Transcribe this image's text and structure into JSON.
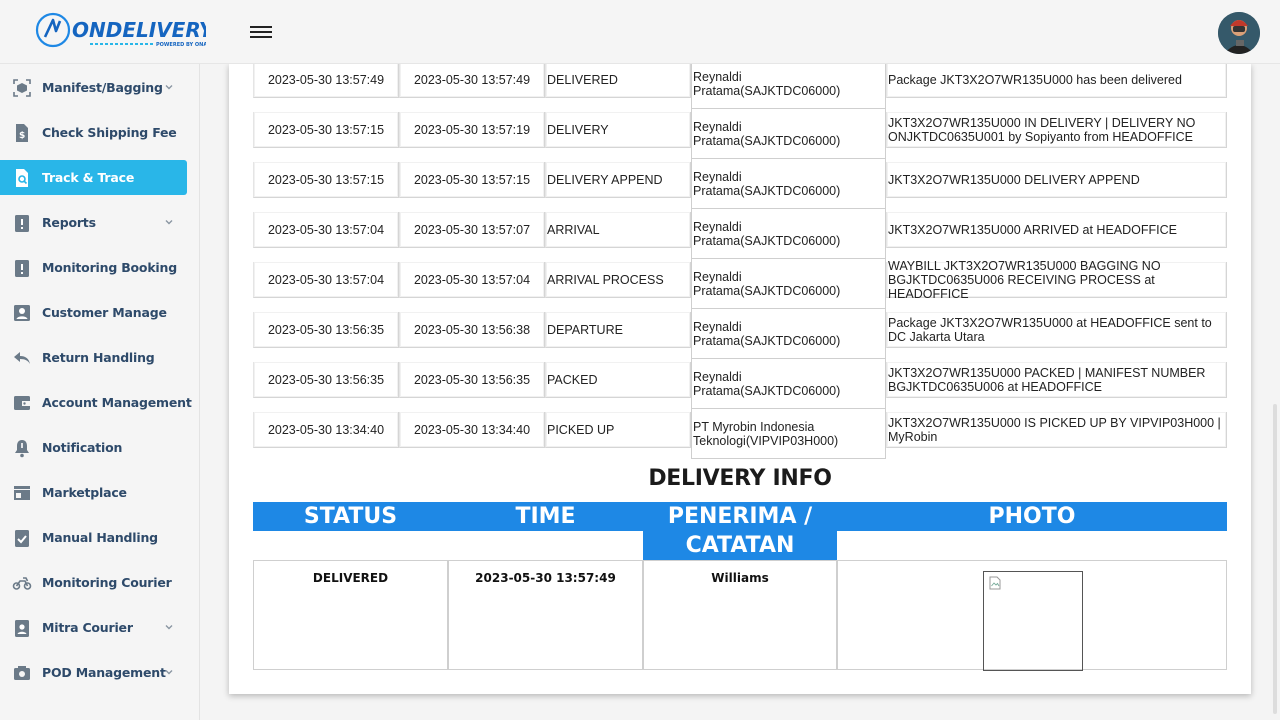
{
  "header": {
    "logo_text": "ONDELIVERY",
    "logo_tagline": "POWERED BY ONAPPS"
  },
  "sidebar": {
    "items": [
      {
        "label": "Manifest/Bagging",
        "icon": "box-scan-icon",
        "chevron": true
      },
      {
        "label": "Check Shipping Fee",
        "icon": "dollar-document-icon",
        "chevron": false
      },
      {
        "label": "Track & Trace",
        "icon": "search-document-icon",
        "chevron": false,
        "active": true
      },
      {
        "label": "Reports",
        "icon": "alert-clipboard-icon",
        "chevron": true
      },
      {
        "label": "Monitoring Booking",
        "icon": "alert-clipboard-icon",
        "chevron": false
      },
      {
        "label": "Customer Manage",
        "icon": "person-card-icon",
        "chevron": false
      },
      {
        "label": "Return Handling",
        "icon": "reply-arrow-icon",
        "chevron": false
      },
      {
        "label": "Account Management",
        "icon": "wallet-icon",
        "chevron": false
      },
      {
        "label": "Notification",
        "icon": "bell-alert-icon",
        "chevron": false
      },
      {
        "label": "Marketplace",
        "icon": "store-icon",
        "chevron": false
      },
      {
        "label": "Manual Handling",
        "icon": "check-clipboard-icon",
        "chevron": false
      },
      {
        "label": "Monitoring Courier",
        "icon": "motorcycle-icon",
        "chevron": false
      },
      {
        "label": "Mitra Courier",
        "icon": "id-badge-icon",
        "chevron": true
      },
      {
        "label": "POD Management",
        "icon": "camera-icon",
        "chevron": true
      }
    ]
  },
  "tracking": {
    "rows": [
      {
        "time1": "2023-05-30 13:57:49",
        "time2": "2023-05-30 13:57:49",
        "status": "DELIVERED",
        "user": "Reynaldi Pratama(SAJKTDC06000)",
        "desc": "Package JKT3X2O7WR135U000 has been delivered"
      },
      {
        "time1": "2023-05-30 13:57:15",
        "time2": "2023-05-30 13:57:19",
        "status": "DELIVERY",
        "user": "Reynaldi Pratama(SAJKTDC06000)",
        "desc": "JKT3X2O7WR135U000 IN DELIVERY | DELIVERY NO ONJKTDC0635U001 by Sopiyanto from HEADOFFICE"
      },
      {
        "time1": "2023-05-30 13:57:15",
        "time2": "2023-05-30 13:57:15",
        "status": "DELIVERY APPEND",
        "user": "Reynaldi Pratama(SAJKTDC06000)",
        "desc": "JKT3X2O7WR135U000 DELIVERY APPEND"
      },
      {
        "time1": "2023-05-30 13:57:04",
        "time2": "2023-05-30 13:57:07",
        "status": "ARRIVAL",
        "user": "Reynaldi Pratama(SAJKTDC06000)",
        "desc": "JKT3X2O7WR135U000 ARRIVED at HEADOFFICE"
      },
      {
        "time1": "2023-05-30 13:57:04",
        "time2": "2023-05-30 13:57:04",
        "status": "ARRIVAL PROCESS",
        "user": "Reynaldi Pratama(SAJKTDC06000)",
        "desc": "WAYBILL JKT3X2O7WR135U000 BAGGING NO BGJKTDC0635U006 RECEIVING PROCESS at HEADOFFICE"
      },
      {
        "time1": "2023-05-30 13:56:35",
        "time2": "2023-05-30 13:56:38",
        "status": "DEPARTURE",
        "user": "Reynaldi Pratama(SAJKTDC06000)",
        "desc": "Package JKT3X2O7WR135U000 at HEADOFFICE sent to DC Jakarta Utara"
      },
      {
        "time1": "2023-05-30 13:56:35",
        "time2": "2023-05-30 13:56:35",
        "status": "PACKED",
        "user": "Reynaldi Pratama(SAJKTDC06000)",
        "desc": "JKT3X2O7WR135U000 PACKED | MANIFEST NUMBER BGJKTDC0635U006 at HEADOFFICE"
      },
      {
        "time1": "2023-05-30 13:34:40",
        "time2": "2023-05-30 13:34:40",
        "status": "PICKED UP",
        "user": "PT Myrobin Indonesia Teknologi(VIPVIP03H000)",
        "desc": "JKT3X2O7WR135U000 IS PICKED UP BY VIPVIP03H000 | MyRobin"
      }
    ]
  },
  "delivery_info": {
    "title": "DELIVERY INFO",
    "headers": {
      "status": "STATUS",
      "time": "TIME",
      "receiver": "PENERIMA / CATATAN",
      "photo": "PHOTO"
    },
    "status": "DELIVERED",
    "time": "2023-05-30 13:57:49",
    "receiver": "Williams"
  },
  "colors": {
    "accent": "#29b6e8",
    "header_band": "#1e88e5",
    "nav_text": "#2e4a6a",
    "logo_blue": "#1565c0"
  }
}
